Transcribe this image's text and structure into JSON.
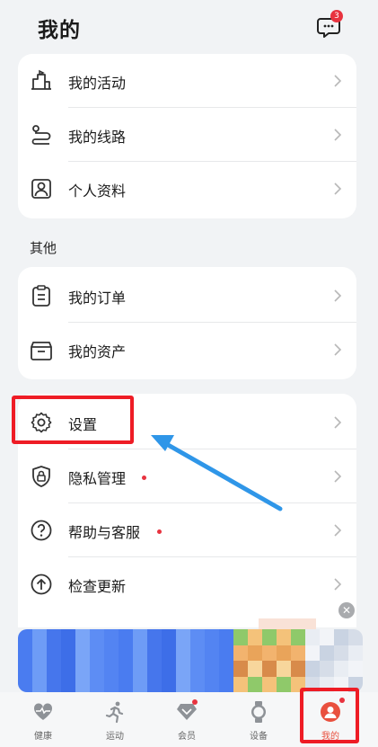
{
  "header": {
    "title": "我的",
    "message_badge": "3"
  },
  "card1": {
    "items": [
      {
        "label": "我的活动",
        "icon": "activity-flag-icon"
      },
      {
        "label": "我的线路",
        "icon": "route-icon"
      },
      {
        "label": "个人资料",
        "icon": "profile-card-icon"
      }
    ]
  },
  "section_other": {
    "title": "其他"
  },
  "card2": {
    "items": [
      {
        "label": "我的订单",
        "icon": "order-clipboard-icon"
      },
      {
        "label": "我的资产",
        "icon": "asset-box-icon"
      }
    ]
  },
  "card3": {
    "items": [
      {
        "label": "设置",
        "icon": "gear-icon"
      },
      {
        "label": "隐私管理",
        "icon": "privacy-lock-icon",
        "dot": true
      },
      {
        "label": "帮助与客服",
        "icon": "help-icon",
        "dot": true
      },
      {
        "label": "检查更新",
        "icon": "update-arrow-icon"
      }
    ]
  },
  "tabbar": {
    "tabs": [
      {
        "label": "健康",
        "icon": "heart-pulse-icon"
      },
      {
        "label": "运动",
        "icon": "runner-icon"
      },
      {
        "label": "会员",
        "icon": "diamond-icon",
        "dot": true
      },
      {
        "label": "设备",
        "icon": "watch-icon"
      },
      {
        "label": "我的",
        "icon": "me-avatar-icon",
        "active": true
      }
    ]
  },
  "colors": {
    "accent": "#e9503e",
    "highlight": "#ee1c25",
    "arrow": "#2f96e8",
    "badge": "#e8333f"
  }
}
